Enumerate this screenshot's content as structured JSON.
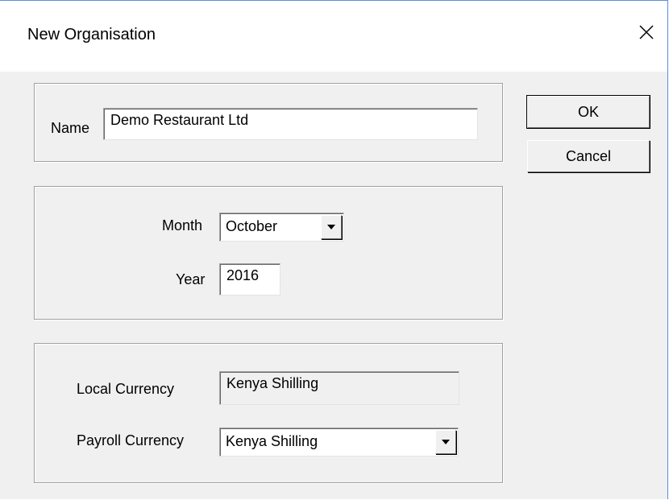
{
  "window": {
    "title": "New Organisation"
  },
  "name_group": {
    "label": "Name",
    "value": "Demo Restaurant Ltd"
  },
  "period_group": {
    "month_label": "Month",
    "month_value": "October",
    "year_label": "Year",
    "year_value": "2016"
  },
  "currency_group": {
    "local_label": "Local Currency",
    "local_value": "Kenya Shilling",
    "payroll_label": "Payroll Currency",
    "payroll_value": "Kenya Shilling"
  },
  "buttons": {
    "ok": "OK",
    "cancel": "Cancel"
  },
  "icons": {
    "close": "close-icon",
    "dropdown": "chevron-down-icon"
  },
  "colors": {
    "window_border": "#5b8fd6",
    "dialog_background": "#f0f0f0"
  }
}
